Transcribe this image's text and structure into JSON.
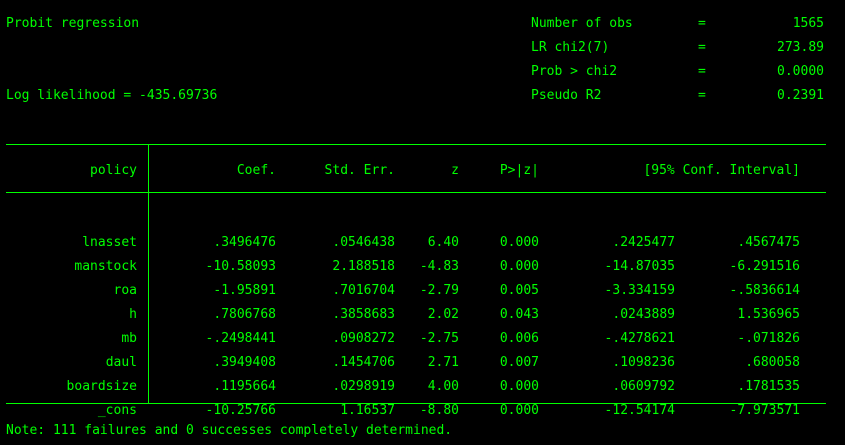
{
  "header": {
    "title": "Probit regression",
    "loglik": "Log likelihood = -435.69736",
    "stats": [
      {
        "name": "Number of obs",
        "eq": "=",
        "value": "1565"
      },
      {
        "name": "LR chi2(7)",
        "eq": "=",
        "value": "273.89"
      },
      {
        "name": "Prob > chi2",
        "eq": "=",
        "value": "0.0000"
      },
      {
        "name": "Pseudo R2",
        "eq": "=",
        "value": "0.2391"
      }
    ]
  },
  "table": {
    "columns": {
      "var": "policy",
      "coef": "Coef.",
      "se": "Std. Err.",
      "z": "z",
      "p": "P>|z|",
      "ci": "[95% Conf. Interval]"
    },
    "rows": [
      {
        "var": "lnasset",
        "coef": ".3496476",
        "se": ".0546438",
        "z": "6.40",
        "p": "0.000",
        "lo": ".2425477",
        "hi": ".4567475"
      },
      {
        "var": "manstock",
        "coef": "-10.58093",
        "se": "2.188518",
        "z": "-4.83",
        "p": "0.000",
        "lo": "-14.87035",
        "hi": "-6.291516"
      },
      {
        "var": "roa",
        "coef": "-1.95891",
        "se": ".7016704",
        "z": "-2.79",
        "p": "0.005",
        "lo": "-3.334159",
        "hi": "-.5836614"
      },
      {
        "var": "h",
        "coef": ".7806768",
        "se": ".3858683",
        "z": "2.02",
        "p": "0.043",
        "lo": ".0243889",
        "hi": "1.536965"
      },
      {
        "var": "mb",
        "coef": "-.2498441",
        "se": ".0908272",
        "z": "-2.75",
        "p": "0.006",
        "lo": "-.4278621",
        "hi": "-.071826"
      },
      {
        "var": "daul",
        "coef": ".3949408",
        "se": ".1454706",
        "z": "2.71",
        "p": "0.007",
        "lo": ".1098236",
        "hi": ".680058"
      },
      {
        "var": "boardsize",
        "coef": ".1195664",
        "se": ".0298919",
        "z": "4.00",
        "p": "0.000",
        "lo": ".0609792",
        "hi": ".1781535"
      },
      {
        "var": "_cons",
        "coef": "-10.25766",
        "se": "1.16537",
        "z": "-8.80",
        "p": "0.000",
        "lo": "-12.54174",
        "hi": "-7.973571"
      }
    ]
  },
  "note": "Note: 111 failures and 0 successes completely determined.",
  "colors": {
    "text": "#00ff00",
    "background": "#000000"
  }
}
